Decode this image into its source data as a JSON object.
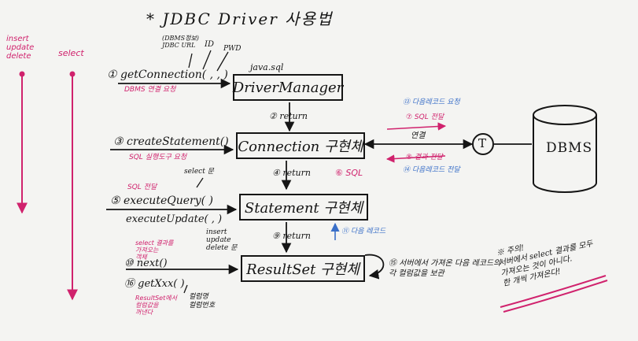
{
  "title": "*   JDBC  Driver  사용법",
  "left_labels": {
    "insert_update_delete": "insert\nupdate\ndelete",
    "select": "select"
  },
  "boxes": {
    "driver_manager_pkg": "java.sql",
    "driver_manager": "DriverManager",
    "connection": "Connection 구현체",
    "statement": "Statement 구현체",
    "resultset": "ResultSet 구현체",
    "dbms": "DBMS",
    "transaction": "T"
  },
  "calls": {
    "get_connection": "① getConnection(  ,  ,  )",
    "get_connection_params": [
      "(DBMS정보)\nJDBC URL",
      "ID",
      "PWD"
    ],
    "dbms_connect_request": "DBMS 연결 요청",
    "create_statement": "③ createStatement()",
    "sql_executor_request": "SQL 실행도구 요청",
    "sql_send": "SQL 전달",
    "select_stmt": "select 문",
    "execute_query": "⑤ executeQuery(  )",
    "execute_update": "executeUpdate(  ,  )",
    "insert_update_delete_stmt": "insert\nupdate\ndelete 문",
    "select_result_note": "select 결과를\n가져오는\n객체",
    "next": "⑩ next()",
    "get_xxx": "⑯ getXxx(  )",
    "resultset_read_note": "ResultSet에서\n컬럼값을\n꺼낸다",
    "column_args": "컬럼명\n컬럼번호"
  },
  "returns": {
    "r2": "② return",
    "r4": "④ return",
    "r6_sql": "⑥ SQL",
    "r9": "⑨ return",
    "next_record": "⑪ 다음 레코드"
  },
  "connection_side": {
    "n13": "⑬ 다음레코드 요청",
    "n7": "⑦ SQL 전달",
    "link_label": "연결",
    "n8": "⑧ 결과 전달",
    "n14": "⑭ 다음레코드 전달"
  },
  "notes": {
    "server_note": "⑮ 서버에서 가져온 다음 레코드의\n각 컬럼값을 보관",
    "warning": "※ 주의!\n서버에서 select 결과를 모두\n가져오는 것이 아니다.\n한 개씩 가져온다!"
  }
}
